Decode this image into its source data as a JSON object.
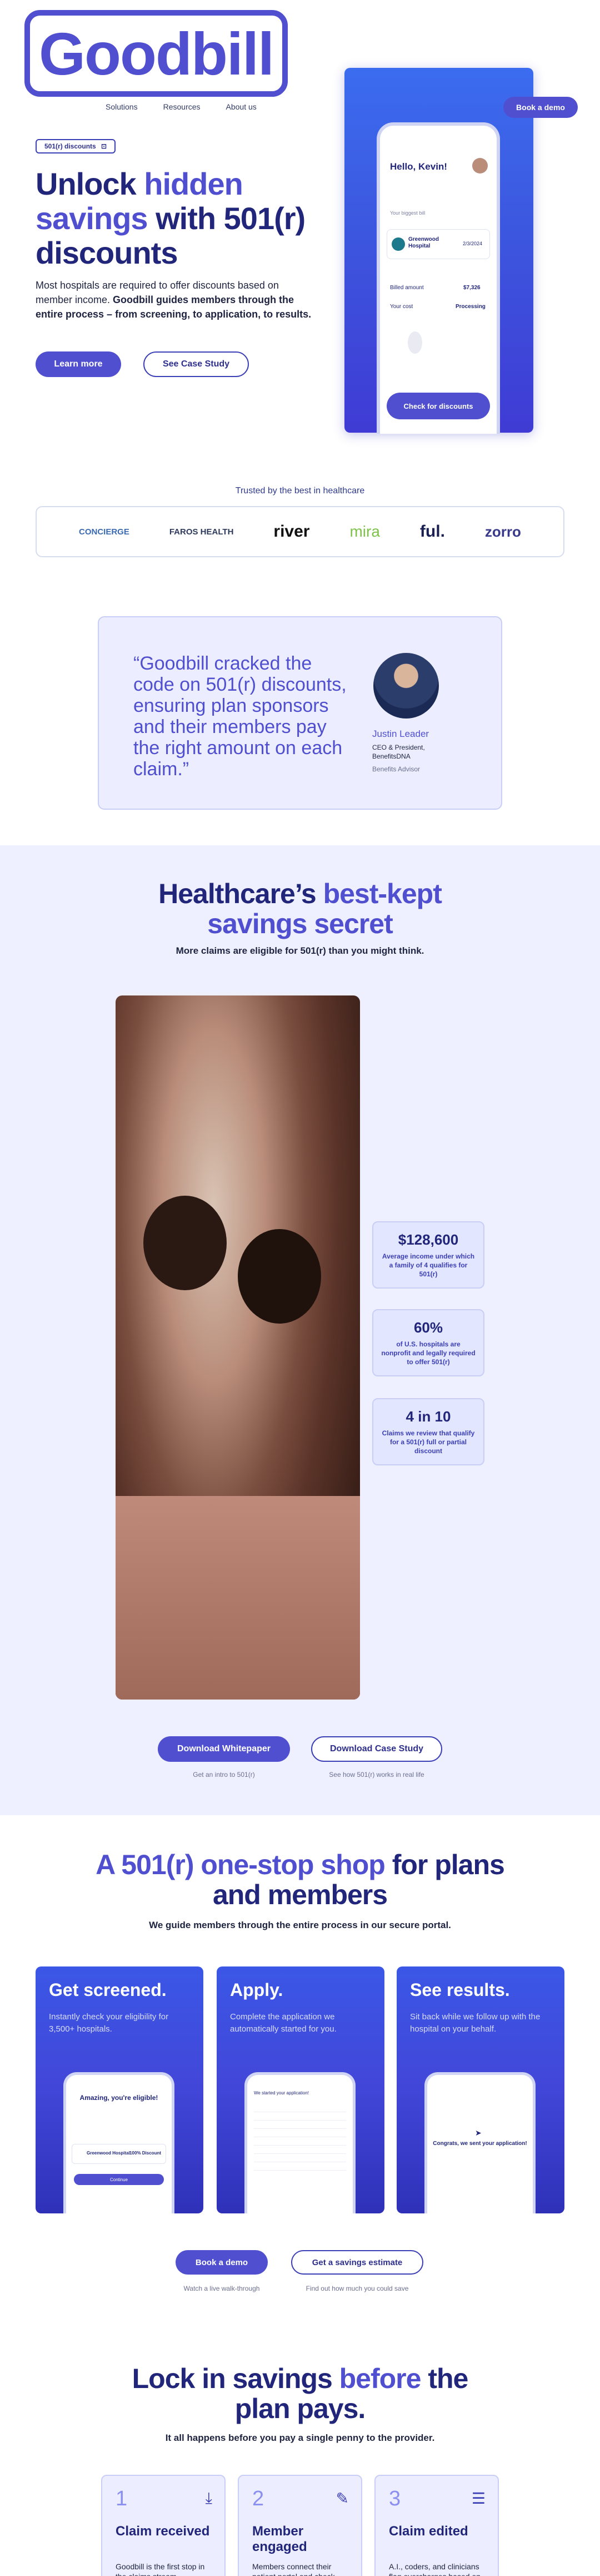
{
  "header": {
    "logo": "Goodbill",
    "nav": [
      "Solutions",
      "Resources",
      "About us"
    ],
    "demo_button": "Book a demo"
  },
  "hero": {
    "pill": "501(r) discounts",
    "pill_icon": "badge-icon",
    "title_part1": "Unlock ",
    "title_accent": "hidden savings",
    "title_part2": " with 501(r) discounts",
    "paragraph_plain": "Most hospitals are required to offer discounts based on member income. ",
    "paragraph_bold": "Goodbill guides members through the entire process – from screening, to application, to results.",
    "learn_more": "Learn more",
    "case_study": "See Case Study"
  },
  "phone": {
    "greeting": "Hello, Kevin!",
    "subtitle": "Your biggest bill",
    "hospital": "Greenwood Hospital",
    "date": "2/3/2024",
    "billed_label": "Billed amount",
    "billed_value": "$7,326",
    "cost_label": "Your cost",
    "cost_value": "Processing",
    "cta": "Check for discounts"
  },
  "trusted": {
    "title": "Trusted by the best in healthcare",
    "logos": [
      "CONCIERGE",
      "FAROS HEALTH",
      "river",
      "mira",
      "ful.",
      "zorro"
    ]
  },
  "testimonial": {
    "quote": "“Goodbill cracked the code on 501(r) discounts, ensuring plan sponsors and their members pay the right amount on each claim.”",
    "name": "Justin Leader",
    "role": "CEO & President, BenefitsDNA",
    "tag": "Benefits Advisor"
  },
  "secret": {
    "title_part1": "Healthcare’s ",
    "title_accent": "best-kept savings secret",
    "subtitle": "More claims are eligible for 501(r) than you might think.",
    "stats": [
      {
        "value": "$128,600",
        "desc": "Average income under which a family of 4 qualifies for 501(r)"
      },
      {
        "value": "60%",
        "desc": "of U.S. hospitals are nonprofit and legally required to offer 501(r)"
      },
      {
        "value": "4 in 10",
        "desc": "Claims we review that qualify for a 501(r) full or partial discount"
      }
    ],
    "whitepaper": "Download Whitepaper",
    "whitepaper_caption": "Get an intro to 501(r)",
    "case_study": "Download Case Study",
    "case_caption": "See how 501(r) works in real life"
  },
  "onestop": {
    "title_accent": "A 501(r) one-stop shop",
    "title_part2": " for plans and members",
    "subtitle": "We guide members through the entire process in our secure portal.",
    "cards": [
      {
        "title": "Get screened.",
        "desc": "Instantly check your eligibility for 3,500+ hospitals.",
        "screen_title": "Amazing, you're eligible!",
        "screen_line": "Greenwood Hospital",
        "screen_badge": "100% Discount",
        "screen_btn": "Continue"
      },
      {
        "title": "Apply.",
        "desc": "Complete the application we automatically started for you.",
        "screen_title": "We started your application!"
      },
      {
        "title": "See results.",
        "desc": "Sit back while we follow up with the hospital on your behalf.",
        "screen_title": "Congrats, we sent your application!"
      }
    ],
    "demo": "Book a demo",
    "demo_caption": "Watch a live walk-through",
    "estimate": "Get a savings estimate",
    "estimate_caption": "Find out how much you could save"
  },
  "lock": {
    "title_part1": "Lock in savings ",
    "title_accent": "before",
    "title_part2": " the plan pays.",
    "subtitle": "It all happens before you pay a single penny to the provider.",
    "steps": [
      {
        "num": "1",
        "title": "Claim received",
        "desc": "Goodbill is the first stop in the claims stream.",
        "icon": "download-icon"
      },
      {
        "num": "2",
        "title": "Member engaged",
        "desc": "Members connect their patient portal and check",
        "icon": "pen-icon"
      },
      {
        "num": "3",
        "title": "Claim edited",
        "desc": "A.I., coders, and clinicians flag overcharges based on provider notes.",
        "icon": "search-list-icon"
      }
    ]
  }
}
